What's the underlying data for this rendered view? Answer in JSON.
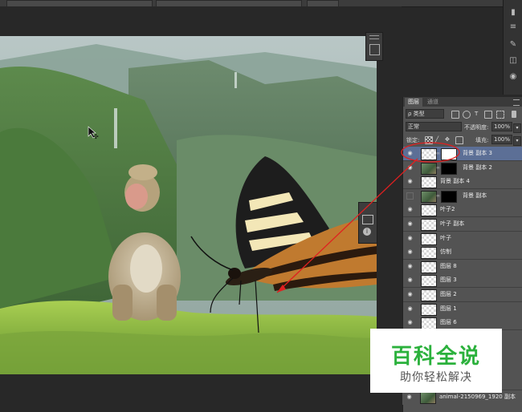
{
  "canvas": {
    "title": "animal-2150969_1920"
  },
  "layers_panel": {
    "tabs": [
      "图层",
      "通道"
    ],
    "filter_kind": "ρ 类型",
    "blend_mode": "正常",
    "opacity_label": "不透明度:",
    "opacity_value": "100%",
    "lock_label": "锁定:",
    "fill_label": "填充:",
    "fill_value": "100%",
    "layers": [
      {
        "name": "背景 副本 3",
        "visible": true,
        "thumb": "checker",
        "mask": "white",
        "selected": true
      },
      {
        "name": "背景 副本 2",
        "visible": true,
        "thumb": "photo",
        "mask": "black",
        "selected": false
      },
      {
        "name": "背景 副本 4",
        "visible": true,
        "thumb": "checker",
        "mask": "none",
        "selected": false
      },
      {
        "name": "背景 副本",
        "visible": false,
        "thumb": "photo",
        "mask": "black",
        "selected": false
      },
      {
        "name": "叶子2",
        "visible": true,
        "thumb": "checker",
        "mask": "none",
        "selected": false
      },
      {
        "name": "叶子 副本",
        "visible": true,
        "thumb": "checker",
        "mask": "none",
        "selected": false
      },
      {
        "name": "叶子",
        "visible": true,
        "thumb": "checker",
        "mask": "none",
        "selected": false
      },
      {
        "name": "仿制",
        "visible": true,
        "thumb": "checker",
        "mask": "none",
        "selected": false
      },
      {
        "name": "图层 8",
        "visible": true,
        "thumb": "checker",
        "mask": "none",
        "selected": false
      },
      {
        "name": "图层 3",
        "visible": true,
        "thumb": "checker",
        "mask": "none",
        "selected": false
      },
      {
        "name": "图层 2",
        "visible": true,
        "thumb": "checker",
        "mask": "none",
        "selected": false
      },
      {
        "name": "图层 1",
        "visible": true,
        "thumb": "checker",
        "mask": "none",
        "selected": false
      },
      {
        "name": "图层 6",
        "visible": true,
        "thumb": "checker",
        "mask": "none",
        "selected": false
      }
    ],
    "bottom_layer": "animal-2150969_1920 副本"
  },
  "watermark": {
    "line1": "百科全说",
    "line2": "助你轻松解决",
    "color": "#2bb13c"
  },
  "annotation": {
    "color": "#e02020"
  }
}
